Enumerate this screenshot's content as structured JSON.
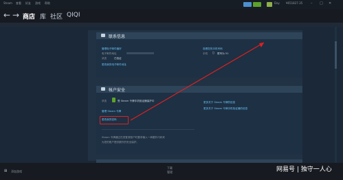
{
  "titlebar": {
    "menu": [
      "Steam",
      "查看",
      "好友",
      "游戏",
      "帮助"
    ],
    "user": "Day",
    "balance": "¥651827.35"
  },
  "nav": {
    "back": "←",
    "forward": "→",
    "items": [
      "商店",
      "库",
      "社区",
      "QIQI"
    ]
  },
  "contact": {
    "title": "联系信息",
    "email_label": "管理电子邮件偏好",
    "email_addr_label": "电子邮件地址",
    "status_label": "状态",
    "status_value": "已验证",
    "change_email": "更改我的电子邮件地址",
    "phone_link": "查看您的手机号码",
    "phone_label": "手机",
    "phone_value": "尾号为 51"
  },
  "security": {
    "title": "帐户安全",
    "state_label": "状态",
    "guard_status": "受 Steam 令牌手机验证器保护中",
    "manage_guard": "管理 Steam 令牌",
    "change_password": "更改我的密码",
    "learn_guard": "更多关于 Steam 令牌的信息",
    "learn_mobile": "更多关于 Steam 令牌手机验证器的信息",
    "guard_desc_1": "Steam 令牌通过在您登录账户时要求输入一串额外代码来",
    "guard_desc_2": "为您的账户提供额外的安全保护。"
  },
  "footer": {
    "add_game": "添加游戏",
    "downloads": "下载",
    "downloads_sub": "管理"
  },
  "watermark": "网易号 | 独守一人心"
}
